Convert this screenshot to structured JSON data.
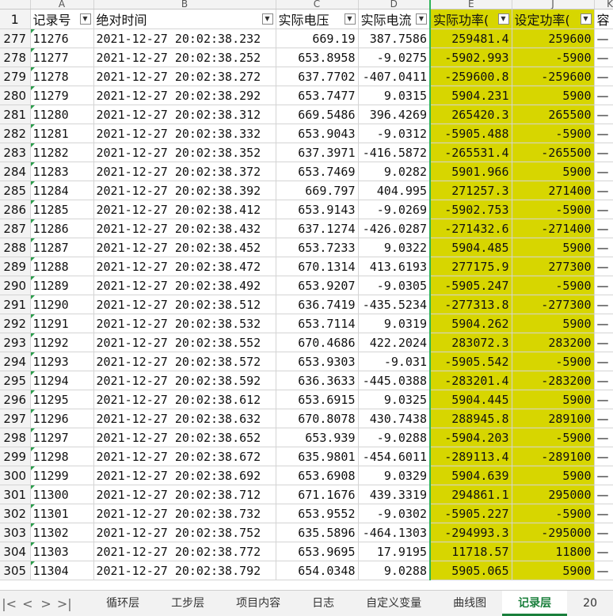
{
  "columns": [
    "A",
    "B",
    "C",
    "D",
    "E",
    "J",
    "K",
    ""
  ],
  "header_row_number": "1",
  "headers": [
    "记录号",
    "绝对时间",
    "实际电压",
    "实际电流",
    "实际功率(",
    "设定功率(",
    "容"
  ],
  "rows": [
    [
      "277",
      "11276",
      "2021-12-27 20:02:38.232",
      "669.19",
      "387.7586",
      "259481.4",
      "259600"
    ],
    [
      "278",
      "11277",
      "2021-12-27 20:02:38.252",
      "653.8958",
      "-9.0275",
      "-5902.993",
      "-5900"
    ],
    [
      "279",
      "11278",
      "2021-12-27 20:02:38.272",
      "637.7702",
      "-407.0411",
      "-259600.8",
      "-259600"
    ],
    [
      "280",
      "11279",
      "2021-12-27 20:02:38.292",
      "653.7477",
      "9.0315",
      "5904.231",
      "5900"
    ],
    [
      "281",
      "11280",
      "2021-12-27 20:02:38.312",
      "669.5486",
      "396.4269",
      "265420.3",
      "265500"
    ],
    [
      "282",
      "11281",
      "2021-12-27 20:02:38.332",
      "653.9043",
      "-9.0312",
      "-5905.488",
      "-5900"
    ],
    [
      "283",
      "11282",
      "2021-12-27 20:02:38.352",
      "637.3971",
      "-416.5872",
      "-265531.4",
      "-265500"
    ],
    [
      "284",
      "11283",
      "2021-12-27 20:02:38.372",
      "653.7469",
      "9.0282",
      "5901.966",
      "5900"
    ],
    [
      "285",
      "11284",
      "2021-12-27 20:02:38.392",
      "669.797",
      "404.995",
      "271257.3",
      "271400"
    ],
    [
      "286",
      "11285",
      "2021-12-27 20:02:38.412",
      "653.9143",
      "-9.0269",
      "-5902.753",
      "-5900"
    ],
    [
      "287",
      "11286",
      "2021-12-27 20:02:38.432",
      "637.1274",
      "-426.0287",
      "-271432.6",
      "-271400"
    ],
    [
      "288",
      "11287",
      "2021-12-27 20:02:38.452",
      "653.7233",
      "9.0322",
      "5904.485",
      "5900"
    ],
    [
      "289",
      "11288",
      "2021-12-27 20:02:38.472",
      "670.1314",
      "413.6193",
      "277175.9",
      "277300"
    ],
    [
      "290",
      "11289",
      "2021-12-27 20:02:38.492",
      "653.9207",
      "-9.0305",
      "-5905.247",
      "-5900"
    ],
    [
      "291",
      "11290",
      "2021-12-27 20:02:38.512",
      "636.7419",
      "-435.5234",
      "-277313.8",
      "-277300"
    ],
    [
      "292",
      "11291",
      "2021-12-27 20:02:38.532",
      "653.7114",
      "9.0319",
      "5904.262",
      "5900"
    ],
    [
      "293",
      "11292",
      "2021-12-27 20:02:38.552",
      "670.4686",
      "422.2024",
      "283072.3",
      "283200"
    ],
    [
      "294",
      "11293",
      "2021-12-27 20:02:38.572",
      "653.9303",
      "-9.031",
      "-5905.542",
      "-5900"
    ],
    [
      "295",
      "11294",
      "2021-12-27 20:02:38.592",
      "636.3633",
      "-445.0388",
      "-283201.4",
      "-283200"
    ],
    [
      "296",
      "11295",
      "2021-12-27 20:02:38.612",
      "653.6915",
      "9.0325",
      "5904.445",
      "5900"
    ],
    [
      "297",
      "11296",
      "2021-12-27 20:02:38.632",
      "670.8078",
      "430.7438",
      "288945.8",
      "289100"
    ],
    [
      "298",
      "11297",
      "2021-12-27 20:02:38.652",
      "653.939",
      "-9.0288",
      "-5904.203",
      "-5900"
    ],
    [
      "299",
      "11298",
      "2021-12-27 20:02:38.672",
      "635.9801",
      "-454.6011",
      "-289113.4",
      "-289100"
    ],
    [
      "300",
      "11299",
      "2021-12-27 20:02:38.692",
      "653.6908",
      "9.0329",
      "5904.639",
      "5900"
    ],
    [
      "301",
      "11300",
      "2021-12-27 20:02:38.712",
      "671.1676",
      "439.3319",
      "294861.1",
      "295000"
    ],
    [
      "302",
      "11301",
      "2021-12-27 20:02:38.732",
      "653.9552",
      "-9.0302",
      "-5905.227",
      "-5900"
    ],
    [
      "303",
      "11302",
      "2021-12-27 20:02:38.752",
      "635.5896",
      "-464.1303",
      "-294993.3",
      "-295000"
    ],
    [
      "304",
      "11303",
      "2021-12-27 20:02:38.772",
      "653.9695",
      "17.9195",
      "11718.57",
      "11800"
    ],
    [
      "305",
      "11304",
      "2021-12-27 20:02:38.792",
      "654.0348",
      "9.0288",
      "5905.065",
      "5900"
    ]
  ],
  "tabs": [
    "循环层",
    "工步层",
    "项目内容",
    "日志",
    "自定义变量",
    "曲线图",
    "记录层",
    "20"
  ],
  "active_tab": 6,
  "nav": {
    "first": "|<",
    "prev": "<",
    "next": ">",
    "last": ">|"
  },
  "colors": {
    "highlight": "#d7d600",
    "accent": "#1a7f3c"
  }
}
